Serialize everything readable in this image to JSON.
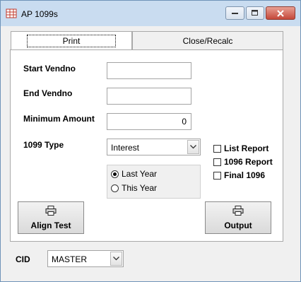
{
  "window": {
    "title": "AP 1099s",
    "icon": "grid-table-icon"
  },
  "tabs": [
    {
      "label": "Print",
      "active": true
    },
    {
      "label": "Close/Recalc",
      "active": false
    }
  ],
  "form": {
    "start_vendno": {
      "label": "Start Vendno",
      "value": ""
    },
    "end_vendno": {
      "label": "End Vendno",
      "value": ""
    },
    "minimum_amount": {
      "label": "Minimum Amount",
      "value": "0"
    },
    "type_1099": {
      "label": "1099 Type",
      "value": "Interest"
    }
  },
  "year_options": [
    {
      "label": "Last Year",
      "selected": true
    },
    {
      "label": "This Year",
      "selected": false
    }
  ],
  "checkboxes": [
    {
      "label": "List Report",
      "checked": false
    },
    {
      "label": "1096 Report",
      "checked": false
    },
    {
      "label": "Final 1096",
      "checked": false
    }
  ],
  "buttons": {
    "align_test": "Align Test",
    "output": "Output"
  },
  "cid": {
    "label": "CID",
    "value": "MASTER"
  }
}
